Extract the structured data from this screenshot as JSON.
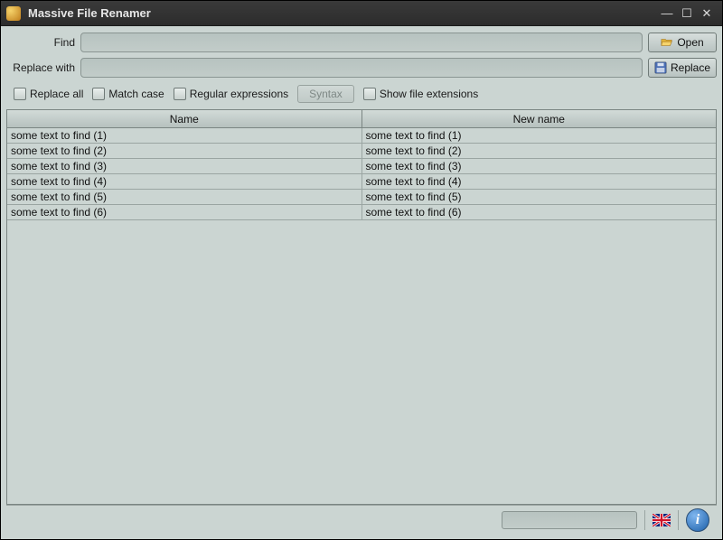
{
  "title": "Massive File Renamer",
  "find": {
    "label": "Find",
    "value": ""
  },
  "replace": {
    "label": "Replace with",
    "value": ""
  },
  "buttons": {
    "open": "Open",
    "replace": "Replace",
    "syntax": "Syntax"
  },
  "options": {
    "replace_all": "Replace all",
    "match_case": "Match case",
    "regex": "Regular expressions",
    "show_ext": "Show file extensions"
  },
  "table": {
    "headers": {
      "name": "Name",
      "new_name": "New name"
    },
    "rows": [
      {
        "name": "some text to find (1)",
        "new_name": "some text to find (1)"
      },
      {
        "name": "some text to find (2)",
        "new_name": "some text to find (2)"
      },
      {
        "name": "some text to find (3)",
        "new_name": "some text to find (3)"
      },
      {
        "name": "some text to find (4)",
        "new_name": "some text to find (4)"
      },
      {
        "name": "some text to find (5)",
        "new_name": "some text to find (5)"
      },
      {
        "name": "some text to find (6)",
        "new_name": "some text to find (6)"
      }
    ]
  },
  "status": {
    "language": "en-GB",
    "info_tooltip": "About"
  }
}
